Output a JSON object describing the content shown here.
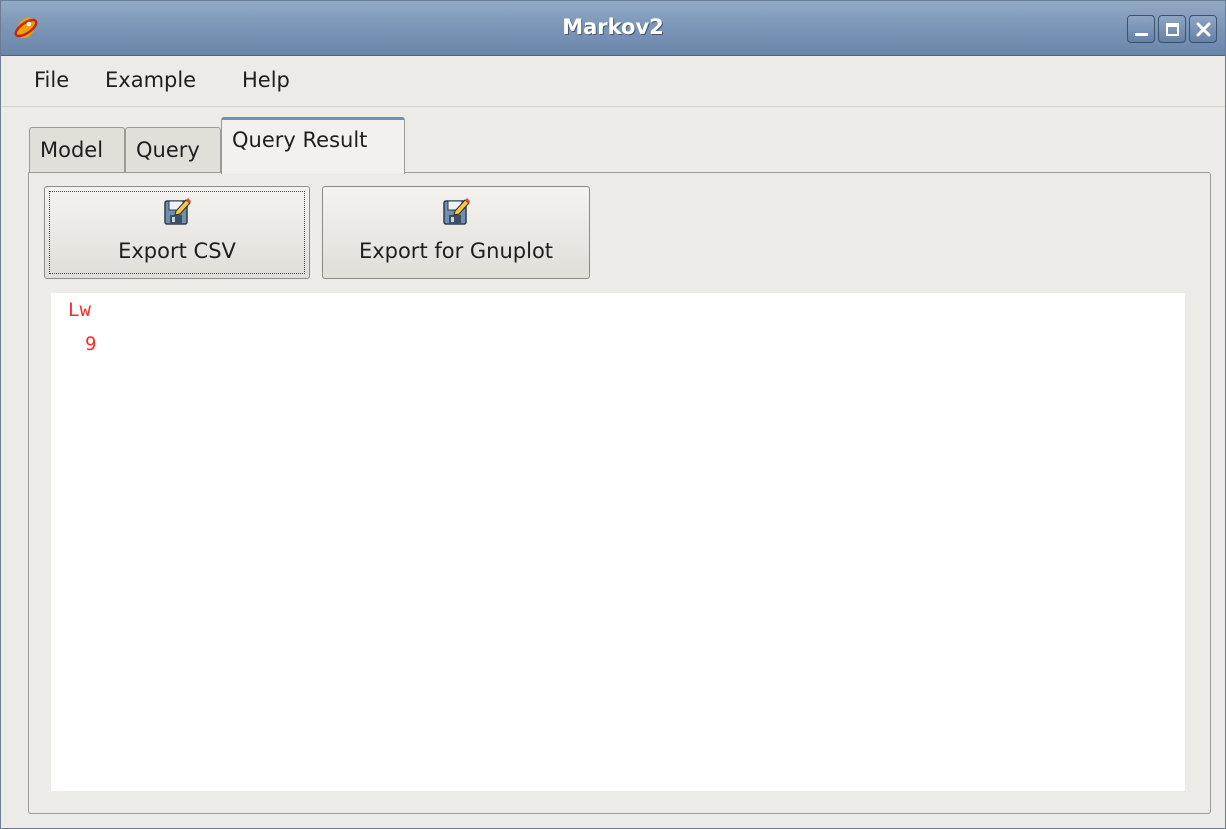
{
  "window": {
    "title": "Markov2",
    "app_icon": "app-logo-icon",
    "title_buttons": [
      "minimize-icon",
      "maximize-icon",
      "close-icon"
    ]
  },
  "menubar": {
    "file": "File",
    "example": "Example",
    "help": "Help"
  },
  "tabs": [
    {
      "label": "Model",
      "active": false
    },
    {
      "label": "Query",
      "active": false
    },
    {
      "label": "Query Result",
      "active": true
    }
  ],
  "toolbar": {
    "export_csv_label": "Export CSV",
    "export_gnuplot_label": "Export for Gnuplot",
    "button_icon": "floppy-edit-icon"
  },
  "result": {
    "header": "Lw",
    "value": "9",
    "text_color": "#ff2a2a"
  },
  "colors": {
    "titlebar": "#7d97b8",
    "window_bg": "#edebe7",
    "active_tab_accent": "#6e8fb6"
  }
}
